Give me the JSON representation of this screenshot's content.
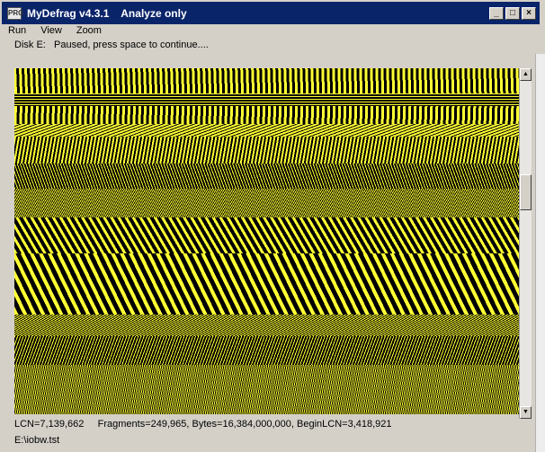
{
  "window": {
    "title": "MyDefrag v4.3.1    Analyze only",
    "app_icon_label": "PRG",
    "controls": {
      "minimize": "_",
      "maximize": "□",
      "close": "×"
    }
  },
  "menu": {
    "items": [
      "Run",
      "View",
      "Zoom"
    ]
  },
  "status": {
    "top": "Disk E:   Paused, press space to continue....",
    "bottom": "LCN=7,139,662     Fragments=249,965, Bytes=16,384,000,000, BeginLCN=3,418,921",
    "path": "E:\\iobw.tst"
  },
  "scrollbar": {
    "up_arrow": "▲",
    "down_arrow": "▼"
  },
  "colors": {
    "map_background": "#000000",
    "map_foreground": "#ffff33",
    "title_bar": "#0a246a",
    "window": "#d4d0c8"
  }
}
